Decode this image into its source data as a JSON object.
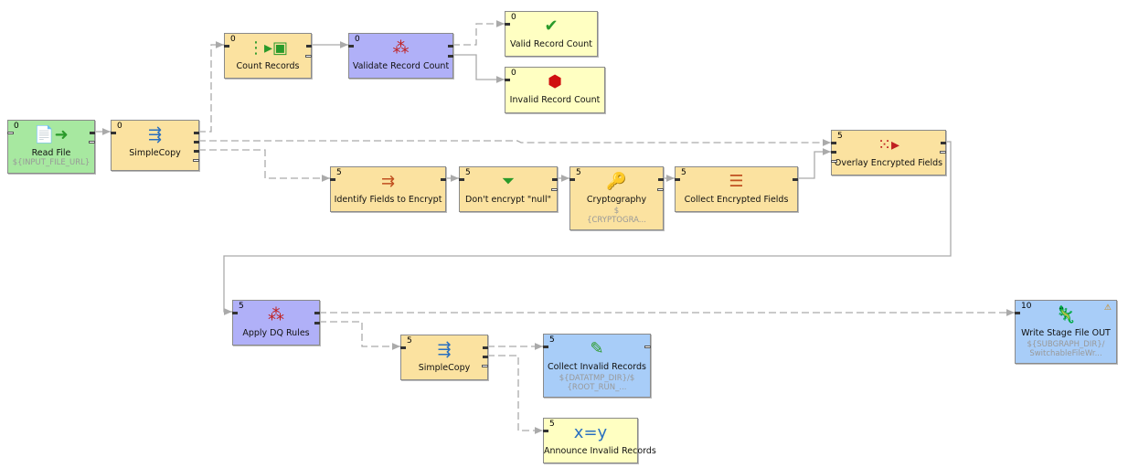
{
  "nodes": {
    "read_file": {
      "phase": "0",
      "label": "Read File",
      "sub": "${INPUT_FILE_URL}",
      "icon": "file-reader-icon"
    },
    "simple_copy_1": {
      "phase": "0",
      "label": "SimpleCopy",
      "icon": "copy-arrows-icon"
    },
    "count_records": {
      "phase": "0",
      "label": "Count Records",
      "icon": "aggregate-icon"
    },
    "validate_record_count": {
      "phase": "0",
      "label": "Validate Record Count",
      "icon": "validator-icon"
    },
    "valid_record_count": {
      "phase": "0",
      "label": "Valid Record Count",
      "icon": "check-icon"
    },
    "invalid_record_count": {
      "phase": "0",
      "label": "Invalid Record Count",
      "icon": "error-icon"
    },
    "identify_fields": {
      "phase": "5",
      "label": "Identify Fields to Encrypt",
      "icon": "normalizer-icon"
    },
    "dont_encrypt_null": {
      "phase": "5",
      "label": "Don't encrypt \"null\"",
      "icon": "filter-icon"
    },
    "cryptography": {
      "phase": "5",
      "label": "Cryptography",
      "sub1": "$",
      "sub2": "{CRYPTOGRA...",
      "icon": "key-icon"
    },
    "collect_encrypted": {
      "phase": "5",
      "label": "Collect Encrypted Fields",
      "icon": "denormalizer-icon"
    },
    "overlay_encrypted": {
      "phase": "5",
      "label": "Overlay Encrypted Fields",
      "icon": "join-icon"
    },
    "apply_dq_rules": {
      "phase": "5",
      "label": "Apply DQ Rules",
      "icon": "validator-icon"
    },
    "simple_copy_2": {
      "phase": "5",
      "label": "SimpleCopy",
      "icon": "copy-arrows-icon"
    },
    "collect_invalid": {
      "phase": "5",
      "label": "Collect Invalid Records",
      "sub1": "${DATATMP_DIR}/$",
      "sub2": "{ROOT_RUN_...",
      "icon": "xls-writer-icon"
    },
    "announce_invalid": {
      "phase": "5",
      "label": "Announce Invalid Records",
      "icon": "transform-icon"
    },
    "write_stage_file": {
      "phase": "10",
      "label": "Write Stage File OUT",
      "sub1": "${SUBGRAPH_DIR}/",
      "sub2": "SwitchableFileWr...",
      "icon": "subgraph-icon",
      "warning": "⚠"
    }
  },
  "colors": {
    "reader": "#a7e8a0",
    "transformer": "#fbe2a0",
    "validator": "#b0b0f8",
    "job": "#ffffc2",
    "writer": "#a8cdf8",
    "edge": "#aaaaaa"
  }
}
